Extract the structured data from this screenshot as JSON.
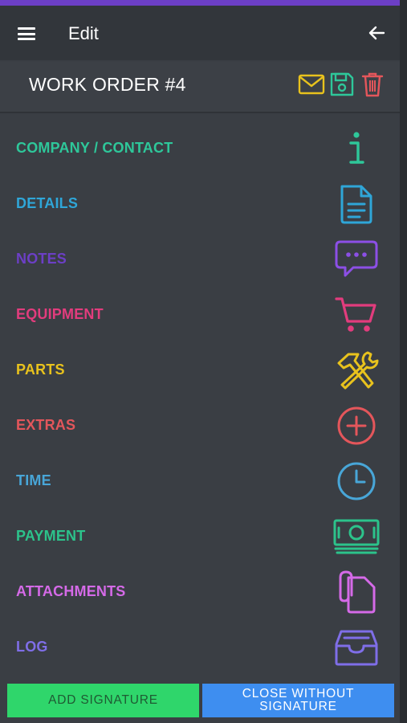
{
  "colors": {
    "accent_bar": "#6c3fc6",
    "company": "#2ec79a",
    "details": "#2fa6d8",
    "notes": "#6c3fc6",
    "equipment": "#e23c7d",
    "parts": "#e8c21d",
    "extras": "#e4565b",
    "time": "#48a6d8",
    "payment": "#2cc38b",
    "attachments": "#d56ae8",
    "log": "#7f6ee8",
    "email_icon": "#e8c21d",
    "save_icon": "#2ec79a",
    "delete_icon": "#e4565b",
    "add_signature_bg": "#2fd66b",
    "close_without_bg": "#3e8ef0"
  },
  "header": {
    "title": "Edit",
    "menu_icon": "hamburger-icon",
    "back_icon": "arrow-left-icon"
  },
  "order": {
    "title": "WORK ORDER #4",
    "actions": [
      "email-icon",
      "save-icon",
      "trash-icon"
    ]
  },
  "menu": [
    {
      "label": "COMPANY / CONTACT",
      "icon": "info-icon"
    },
    {
      "label": "DETAILS",
      "icon": "document-icon"
    },
    {
      "label": "NOTES",
      "icon": "chat-icon"
    },
    {
      "label": "EQUIPMENT",
      "icon": "cart-icon"
    },
    {
      "label": "PARTS",
      "icon": "tools-icon"
    },
    {
      "label": "EXTRAS",
      "icon": "plus-circle-icon"
    },
    {
      "label": "TIME",
      "icon": "clock-icon"
    },
    {
      "label": "PAYMENT",
      "icon": "money-icon"
    },
    {
      "label": "ATTACHMENTS",
      "icon": "attachment-icon"
    },
    {
      "label": "LOG",
      "icon": "inbox-icon"
    }
  ],
  "footer": {
    "add_signature": "ADD SIGNATURE",
    "close_without": "CLOSE WITHOUT SIGNATURE"
  }
}
